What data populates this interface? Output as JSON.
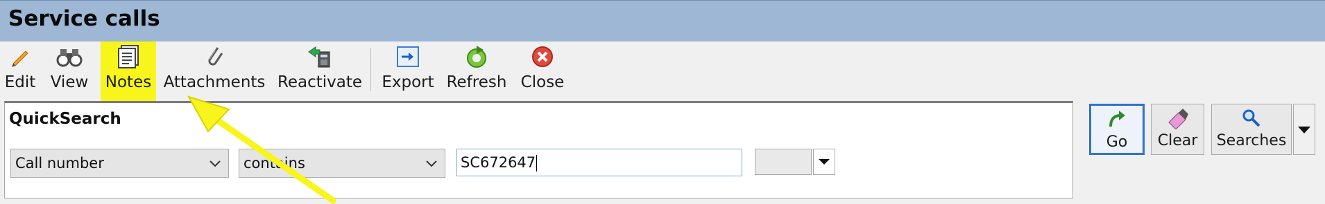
{
  "title": "Service calls",
  "toolbar": {
    "edit": {
      "label": "Edit",
      "icon": "pencil-icon"
    },
    "view": {
      "label": "View",
      "icon": "binoculars-icon"
    },
    "notes": {
      "label": "Notes",
      "icon": "notes-icon",
      "highlight_color": "#f7f51b"
    },
    "attachments": {
      "label": "Attachments",
      "icon": "paperclip-icon"
    },
    "reactivate": {
      "label": "Reactivate",
      "icon": "reactivate-icon"
    },
    "export": {
      "label": "Export",
      "icon": "export-icon"
    },
    "refresh": {
      "label": "Refresh",
      "icon": "refresh-icon"
    },
    "close": {
      "label": "Close",
      "icon": "close-icon"
    }
  },
  "quicksearch": {
    "title": "QuickSearch",
    "field_select": "Call number",
    "operator_select": "contains",
    "value": "SC672647"
  },
  "actions": {
    "go": {
      "label": "Go",
      "icon": "go-arrow-icon",
      "accent": "#2f73c9"
    },
    "clear": {
      "label": "Clear",
      "icon": "eraser-icon"
    },
    "searches": {
      "label": "Searches",
      "icon": "magnifier-icon"
    }
  },
  "annotation": {
    "color": "#f7f51b",
    "icon": "pointer-arrow"
  }
}
